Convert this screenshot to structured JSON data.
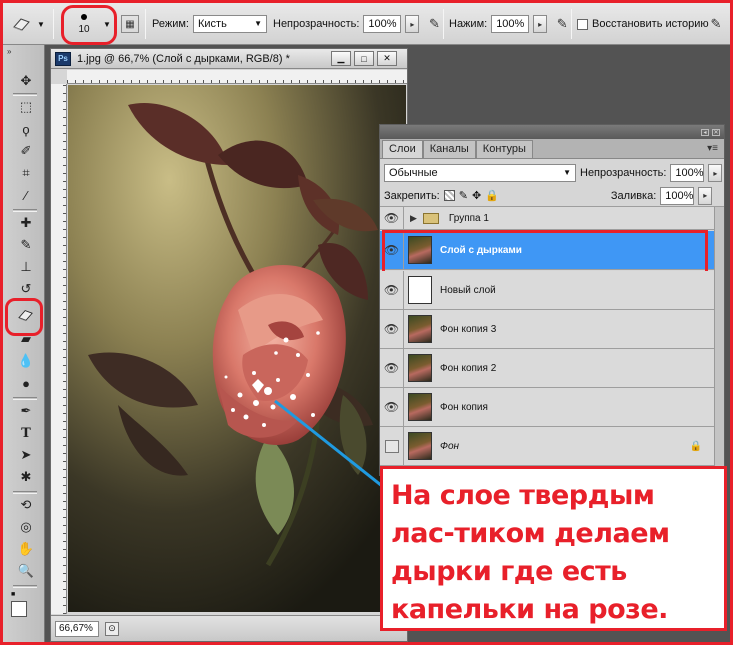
{
  "options": {
    "brush_size": "10",
    "mode_label": "Режим:",
    "mode_value": "Кисть",
    "opacity_label": "Непрозрачность:",
    "opacity_value": "100%",
    "flow_label": "Нажим:",
    "flow_value": "100%",
    "history_label": "Восстановить историю"
  },
  "document": {
    "ps_badge": "Ps",
    "title": "1.jpg @ 66,7% (Слой с дырками, RGB/8) *",
    "zoom": "66,67%"
  },
  "layers_panel": {
    "tabs": [
      "Слои",
      "Каналы",
      "Контуры"
    ],
    "blend_mode": "Обычные",
    "opacity_label": "Непрозрачность:",
    "opacity_value": "100%",
    "lock_label": "Закрепить:",
    "fill_label": "Заливка:",
    "fill_value": "100%",
    "group_name": "Группа 1",
    "layers": [
      {
        "name": "Слой с дырками",
        "selected": true,
        "visible": true,
        "thumb": "white-holes"
      },
      {
        "name": "Новый слой",
        "selected": false,
        "visible": true,
        "thumb": "white"
      },
      {
        "name": "Фон копия 3",
        "selected": false,
        "visible": true,
        "thumb": "rose"
      },
      {
        "name": "Фон копия 2",
        "selected": false,
        "visible": true,
        "thumb": "rose"
      },
      {
        "name": "Фон копия",
        "selected": false,
        "visible": true,
        "thumb": "rose"
      },
      {
        "name": "Фон",
        "selected": false,
        "visible": false,
        "thumb": "rose",
        "locked": true
      }
    ]
  },
  "callout": {
    "text": "На слое твердым лас-тиком делаем дырки где есть капельки на розе."
  },
  "colors": {
    "highlight": "#e8202a",
    "selected_layer": "#3f97f5",
    "pointer_line": "#1f9ae0"
  }
}
